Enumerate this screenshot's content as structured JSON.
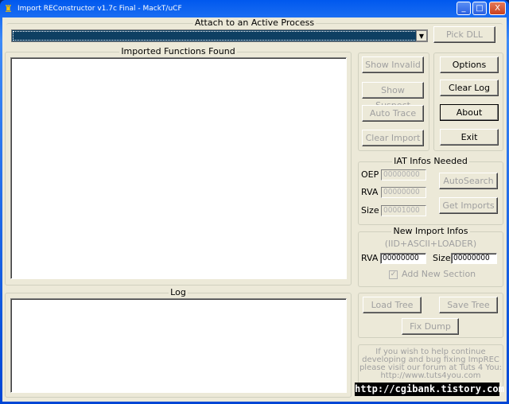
{
  "window": {
    "title": "Import REConstructor v1.7c Final - MackT/uCF",
    "minimize": "_",
    "maximize": "□",
    "close": "X"
  },
  "attach": {
    "caption": "Attach to an Active Process",
    "selected": "",
    "pick_dll": "Pick DLL"
  },
  "imported": {
    "caption": "Imported Functions Found"
  },
  "actions": {
    "show_invalid": "Show Invalid",
    "show_suspect": "Show Suspect",
    "auto_trace": "Auto Trace",
    "clear_import": "Clear Import"
  },
  "main_buttons": {
    "options": "Options",
    "clear_log": "Clear Log",
    "about": "About",
    "exit": "Exit"
  },
  "iat": {
    "caption": "IAT Infos Needed",
    "oep_label": "OEP",
    "oep": "00000000",
    "rva_label": "RVA",
    "rva": "00000000",
    "size_label": "Size",
    "size": "00001000",
    "autosearch": "AutoSearch",
    "get_imports": "Get Imports"
  },
  "new_import": {
    "caption": "New Import Infos",
    "subtitle": "(IID+ASCII+LOADER)",
    "rva_label": "RVA",
    "rva": "00000000",
    "size_label": "Size",
    "size": "00000000",
    "add_section": "Add New Section",
    "add_section_checked": true
  },
  "log": {
    "caption": "Log"
  },
  "tree": {
    "load": "Load Tree",
    "save": "Save Tree",
    "fix_dump": "Fix Dump"
  },
  "info": {
    "lines": [
      "If you wish to help continue",
      "developing and bug fixing ImpREC",
      "please visit our forum at Tuts 4 You:",
      "http://www.tuts4you.com"
    ]
  },
  "watermark": "http://cgibank.tistory.com"
}
